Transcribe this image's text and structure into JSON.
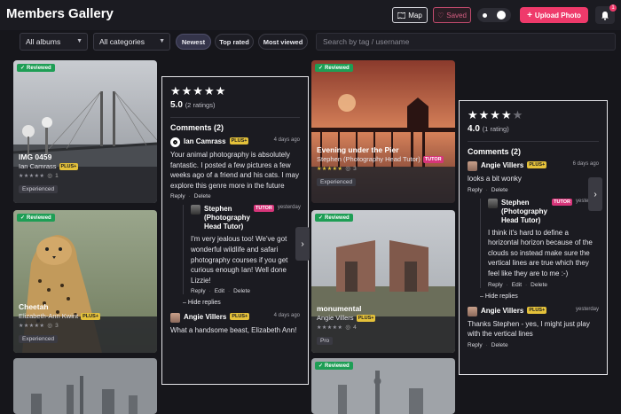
{
  "header": {
    "title": "Members Gallery",
    "map_label": "Map",
    "saved_label": "Saved",
    "upload_label": "Upload Photo",
    "notifications_count": "1"
  },
  "filters": {
    "albums": "All albums",
    "categories": "All categories",
    "sort_newest": "Newest",
    "sort_top_rated": "Top rated",
    "sort_most_viewed": "Most viewed",
    "search_placeholder": "Search by tag / username"
  },
  "cards": [
    {
      "badge": "Reviewed",
      "title": "IMG 0459",
      "author": "Ian Camrass",
      "author_badge": "PLUS+",
      "stars": "★★★★★",
      "comments": "1",
      "level": "Experienced"
    },
    {
      "badge": "Reviewed",
      "title": "Cheetah",
      "author": "Elizabeth-Ann Kwint",
      "author_badge": "PLUS+",
      "stars": "★★★★★",
      "comments": "3",
      "level": "Experienced"
    },
    {
      "badge": "Reviewed",
      "title": "Evening under the Pier",
      "author": "Stephen (Photography Head Tutor)",
      "author_badge": "TUTOR",
      "stars": "★★★★★",
      "comments": "3",
      "level": "Experienced"
    },
    {
      "badge": "Reviewed",
      "title": "monumental",
      "author": "Angie Villers",
      "author_badge": "PLUS+",
      "stars": "★★★★★",
      "comments": "4",
      "level": "Pro"
    },
    {
      "badge": "Reviewed"
    }
  ],
  "panels": [
    {
      "stars": "★★★★★",
      "rating": "5.0",
      "rating_count": "(2 ratings)",
      "comments_title": "Comments (2)",
      "comments": [
        {
          "author": "Ian Camrass",
          "badge": "PLUS+",
          "ago": "4 days ago",
          "text": "Your animal photography is absolutely fantastic. I posted a few pictures a few weeks ago of a friend and his cats. I may explore this genre more in the future",
          "reply": "Reply",
          "delete": "Delete"
        },
        {
          "author": "Stephen (Photography Head Tutor)",
          "badge": "TUTOR",
          "ago": "yesterday",
          "text": "I'm very jealous too! We've got wonderful wildlife and safari photography courses if you get curious enough Ian! Well done Lizzie!",
          "reply": "Reply",
          "edit": "Edit",
          "delete": "Delete"
        },
        {
          "author": "Angie Villers",
          "badge": "PLUS+",
          "ago": "4 days ago",
          "text": "What a handsome beast, Elizabeth Ann!"
        }
      ],
      "hide_replies": "Hide replies"
    },
    {
      "stars": "★★★★",
      "stars_empty": "★",
      "rating": "4.0",
      "rating_count": "(1 rating)",
      "comments_title": "Comments (2)",
      "comments": [
        {
          "author": "Angie Villers",
          "badge": "PLUS+",
          "ago": "6 days ago",
          "text": "looks a bit wonky",
          "reply": "Reply",
          "delete": "Delete"
        },
        {
          "author": "Stephen (Photography Head Tutor)",
          "badge": "TUTOR",
          "ago": "yesterday",
          "text": "I think it's hard to define a horizontal horizon because of the clouds so instead make sure the vertical lines are true which they feel like they are to me :-)",
          "reply": "Reply",
          "edit": "Edit",
          "delete": "Delete"
        },
        {
          "author": "Angie Villers",
          "badge": "PLUS+",
          "ago": "yesterday",
          "text": "Thanks Stephen  - yes, I might just play with the vertical lines",
          "reply": "Reply",
          "delete": "Delete"
        }
      ],
      "hide_replies": "Hide replies"
    }
  ],
  "icons": [
    "map-icon",
    "heart-icon",
    "plus-icon",
    "bell-icon",
    "chevron-down-icon",
    "chevron-right-icon",
    "check-icon",
    "comment-icon"
  ]
}
